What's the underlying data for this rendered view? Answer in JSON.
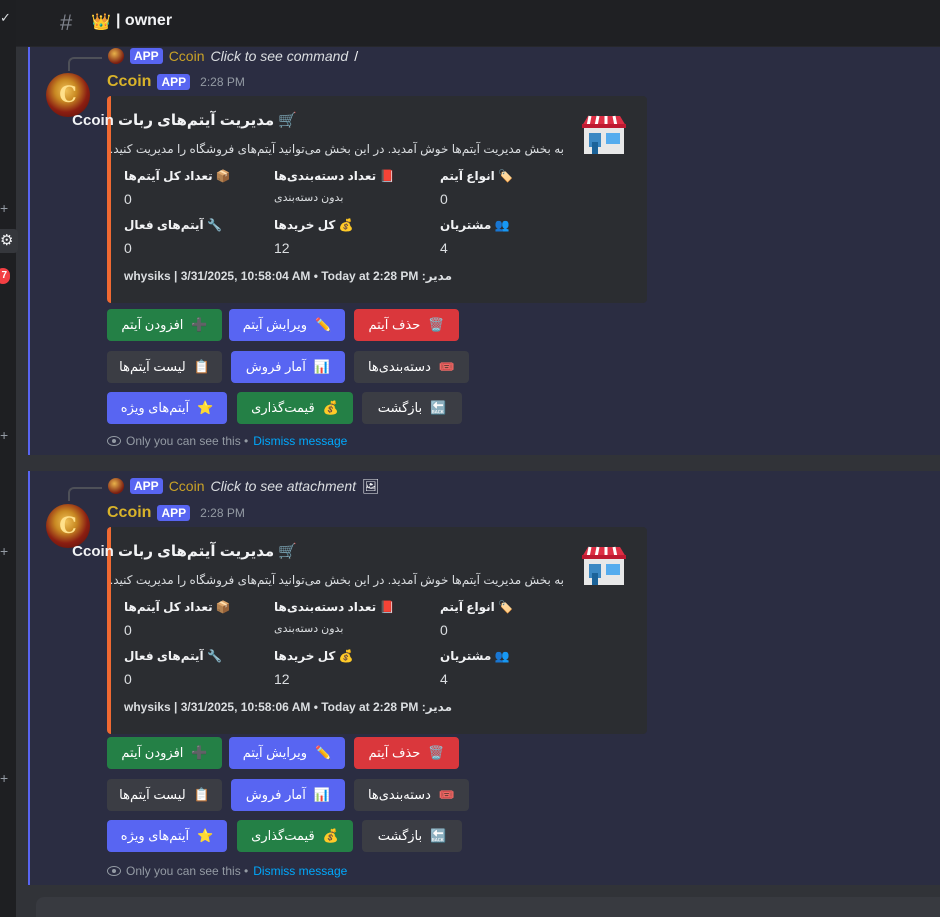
{
  "channel": {
    "name": "owner",
    "crown_icon": "👑"
  },
  "rail": {
    "badge": "7"
  },
  "messages": [
    {
      "reply": {
        "app": "APP",
        "author": "Ccoin",
        "command": "Click to see command",
        "icon": "/"
      },
      "author": "Ccoin",
      "app": "APP",
      "time": "2:28 PM",
      "embed": {
        "title": "🛒 مدیریت آیتم‌های ربات Ccoin",
        "description": "به بخش مدیریت آیتم‌ها خوش آمدید. در این بخش می‌توانید آیتم‌های فروشگاه را مدیریت کنید.",
        "fields": [
          {
            "name": "📦 تعداد کل آیتم‌ها",
            "value": "0"
          },
          {
            "name": "📕 تعداد دسته‌بندی‌ها",
            "value": "بدون دسته‌بندی"
          },
          {
            "name": "🏷️ انواع آیتم",
            "value": "0"
          },
          {
            "name": "🔧 آیتم‌های فعال",
            "value": "0"
          },
          {
            "name": "💰 کل خریدها",
            "value": "12"
          },
          {
            "name": "👥 مشتریان",
            "value": "4"
          }
        ],
        "footer": "whysiks | 3/31/2025, 10:58:04 AM • Today at 2:28 PM :مدیر"
      },
      "buttons": [
        {
          "label": "افزودن آیتم",
          "icon": "➕"
        },
        {
          "label": "ویرایش آیتم",
          "icon": "✏️"
        },
        {
          "label": "حذف آیتم",
          "icon": "🗑️"
        },
        {
          "label": "لیست آیتم‌ها",
          "icon": "📋"
        },
        {
          "label": "آمار فروش",
          "icon": "📊"
        },
        {
          "label": "دسته‌بندی‌ها",
          "icon": "🎟️"
        },
        {
          "label": "آیتم‌های ویژه",
          "icon": "⭐"
        },
        {
          "label": "قیمت‌گذاری",
          "icon": "💰"
        },
        {
          "label": "بازگشت",
          "icon": "🔙"
        }
      ],
      "ephemeral": {
        "text": "Only you can see this •",
        "dismiss": "Dismiss message"
      }
    },
    {
      "reply": {
        "app": "APP",
        "author": "Ccoin",
        "command": "Click to see attachment",
        "icon": "🖼"
      },
      "author": "Ccoin",
      "app": "APP",
      "time": "2:28 PM",
      "embed": {
        "title": "🛒 مدیریت آیتم‌های ربات Ccoin",
        "description": "به بخش مدیریت آیتم‌ها خوش آمدید. در این بخش می‌توانید آیتم‌های فروشگاه را مدیریت کنید.",
        "fields": [
          {
            "name": "📦 تعداد کل آیتم‌ها",
            "value": "0"
          },
          {
            "name": "📕 تعداد دسته‌بندی‌ها",
            "value": "بدون دسته‌بندی"
          },
          {
            "name": "🏷️ انواع آیتم",
            "value": "0"
          },
          {
            "name": "🔧 آیتم‌های فعال",
            "value": "0"
          },
          {
            "name": "💰 کل خریدها",
            "value": "12"
          },
          {
            "name": "👥 مشتریان",
            "value": "4"
          }
        ],
        "footer": "whysiks | 3/31/2025, 10:58:06 AM • Today at 2:28 PM :مدیر"
      },
      "buttons": [
        {
          "label": "افزودن آیتم",
          "icon": "➕"
        },
        {
          "label": "ویرایش آیتم",
          "icon": "✏️"
        },
        {
          "label": "حذف آیتم",
          "icon": "🗑️"
        },
        {
          "label": "لیست آیتم‌ها",
          "icon": "📋"
        },
        {
          "label": "آمار فروش",
          "icon": "📊"
        },
        {
          "label": "دسته‌بندی‌ها",
          "icon": "🎟️"
        },
        {
          "label": "آیتم‌های ویژه",
          "icon": "⭐"
        },
        {
          "label": "قیمت‌گذاری",
          "icon": "💰"
        },
        {
          "label": "بازگشت",
          "icon": "🔙"
        }
      ],
      "ephemeral": {
        "text": "Only you can see this •",
        "dismiss": "Dismiss message"
      }
    }
  ]
}
